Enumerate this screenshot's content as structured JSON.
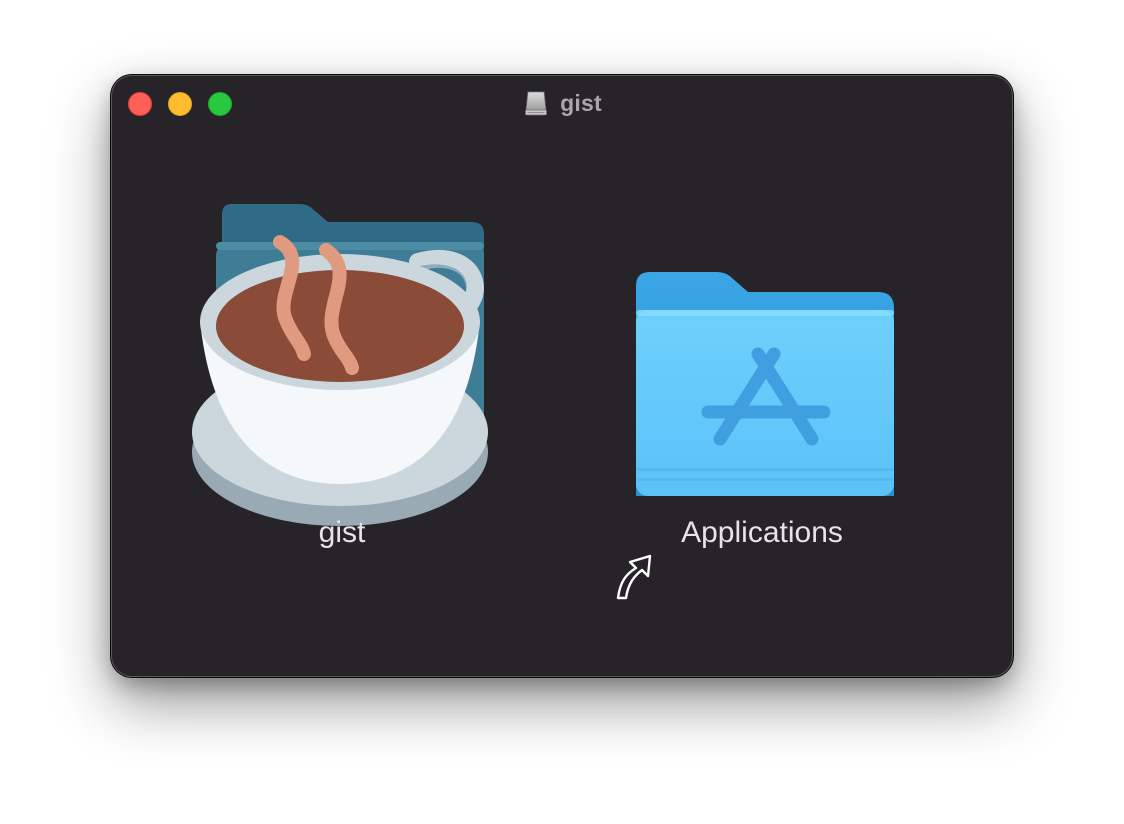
{
  "window": {
    "title": "gist",
    "title_icon": "disk-image-icon",
    "controls": {
      "close": "close-button",
      "minimize": "minimize-button",
      "zoom": "zoom-button"
    }
  },
  "items": [
    {
      "label": "gist",
      "icon": "hot-beverage-app-icon"
    },
    {
      "label": "Applications",
      "icon": "applications-folder-icon",
      "badge": "alias-arrow-icon"
    }
  ],
  "colors": {
    "window_background": "#262428",
    "title_text": "#a9a7ab",
    "label_text": "#e6e4e8",
    "folder_blue": "#62c7fa",
    "close": "#fe5f57",
    "minimize": "#febc2e",
    "zoom": "#28c840"
  }
}
